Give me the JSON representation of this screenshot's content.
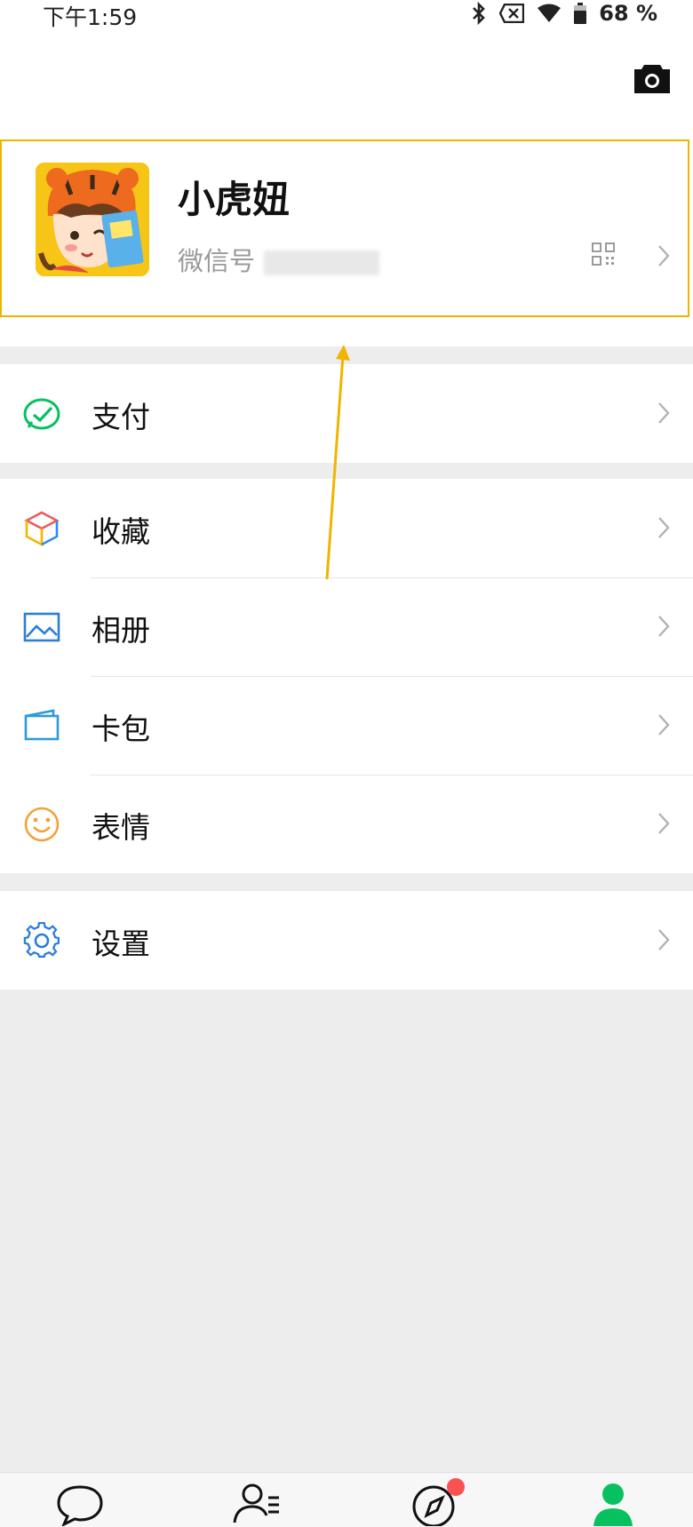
{
  "status_bar": {
    "time": "下午1:59",
    "battery": "68 %"
  },
  "header": {
    "camera_icon": "camera-icon"
  },
  "profile": {
    "nickname": "小虎妞",
    "wechat_id_label": "微信号",
    "qrcode_icon": "qrcode-icon"
  },
  "menu": {
    "pay": "支付",
    "favorites": "收藏",
    "album": "相册",
    "cards": "卡包",
    "stickers": "表情",
    "settings": "设置"
  },
  "tabbar": {
    "items": [
      "chat-icon",
      "contacts-icon",
      "discover-icon",
      "me-icon"
    ],
    "active": "me-icon",
    "discover_badge": true
  },
  "colors": {
    "wechat_green": "#07c160",
    "highlight_border": "#f0b400",
    "badge_red": "#fa5151",
    "background": "#ededed"
  }
}
